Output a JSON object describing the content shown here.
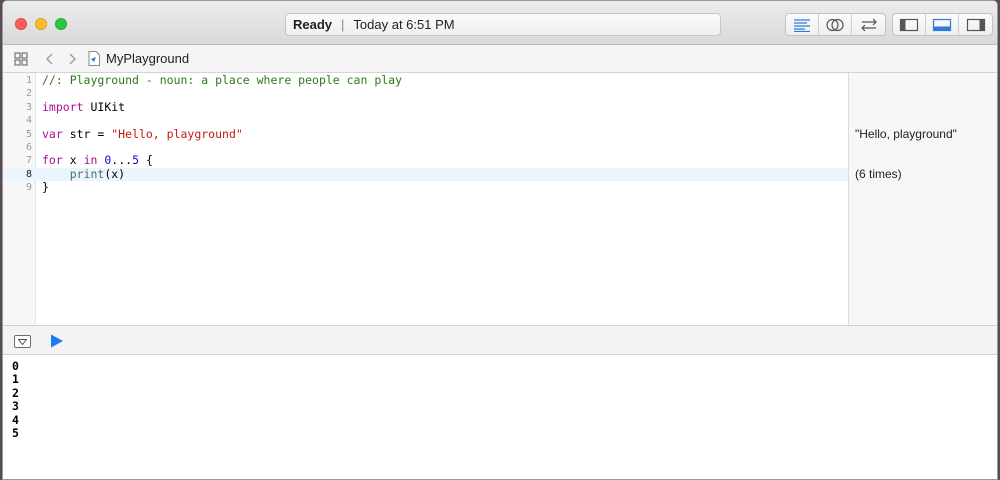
{
  "window": {
    "status": "Ready",
    "timestamp": "Today at 6:51 PM"
  },
  "toolbar": {
    "editor_buttons": [
      "standard-editor-icon",
      "assistant-editor-icon",
      "version-editor-icon"
    ],
    "view_buttons": [
      "navigator-toggle-icon",
      "debug-area-toggle-icon",
      "utilities-toggle-icon"
    ]
  },
  "jumpbar": {
    "title": "MyPlayground"
  },
  "editor": {
    "line_numbers": [
      "1",
      "2",
      "3",
      "4",
      "5",
      "6",
      "7",
      "8",
      "9"
    ],
    "current_line": 8,
    "lines": [
      {
        "tokens": [
          {
            "t": "//: Playground - noun: a place where people can play",
            "c": "comment"
          }
        ]
      },
      {
        "tokens": []
      },
      {
        "tokens": [
          {
            "t": "import",
            "c": "keyword"
          },
          {
            "t": " UIKit",
            "c": "plain"
          }
        ]
      },
      {
        "tokens": []
      },
      {
        "tokens": [
          {
            "t": "var",
            "c": "keyword"
          },
          {
            "t": " str = ",
            "c": "plain"
          },
          {
            "t": "\"Hello, playground\"",
            "c": "string"
          }
        ]
      },
      {
        "tokens": []
      },
      {
        "tokens": [
          {
            "t": "for",
            "c": "keyword"
          },
          {
            "t": " x ",
            "c": "plain"
          },
          {
            "t": "in",
            "c": "keyword"
          },
          {
            "t": " ",
            "c": "plain"
          },
          {
            "t": "0",
            "c": "number"
          },
          {
            "t": "...",
            "c": "plain"
          },
          {
            "t": "5",
            "c": "number"
          },
          {
            "t": " {",
            "c": "plain"
          }
        ]
      },
      {
        "tokens": [
          {
            "t": "    ",
            "c": "plain"
          },
          {
            "t": "print",
            "c": "func"
          },
          {
            "t": "(x)",
            "c": "plain"
          }
        ]
      },
      {
        "tokens": [
          {
            "t": "}",
            "c": "plain"
          }
        ]
      }
    ]
  },
  "results": [
    {
      "line": 5,
      "text": "\"Hello, playground\""
    },
    {
      "line": 8,
      "text": "(6 times)"
    }
  ],
  "console": {
    "output": [
      "0",
      "1",
      "2",
      "3",
      "4",
      "5"
    ]
  },
  "colors": {
    "comment": "#2c7a1a",
    "keyword": "#aa0d91",
    "string": "#c41a16",
    "number": "#1c00cf",
    "accent": "#1a7bf2"
  }
}
